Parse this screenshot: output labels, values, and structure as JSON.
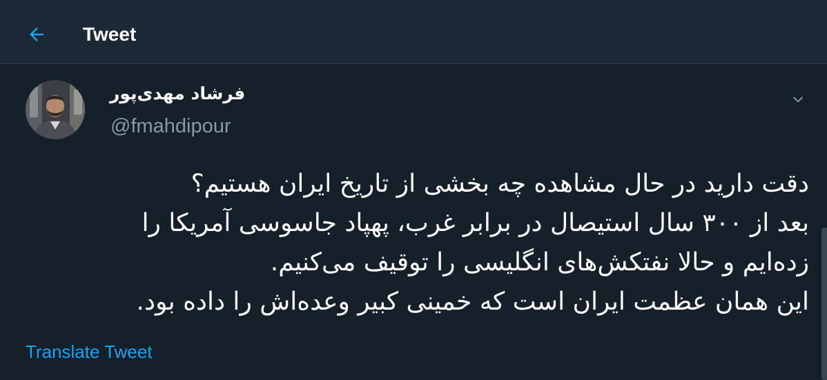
{
  "header": {
    "title": "Tweet",
    "back_icon": "arrow-left-icon",
    "accent_color": "#1da1f2"
  },
  "tweet": {
    "author": {
      "display_name": "فرشاد مهدی‌پور",
      "handle": "@fmahdipour",
      "avatar_icon": "avatar-photo"
    },
    "more_icon": "chevron-down-icon",
    "lines": [
      "دقت دارید در حال مشاهده چه بخشی از تاریخ ایران هستیم؟",
      "بعد از ۳۰۰ سال استیصال در برابر غرب، پهپاد جاسوسی آمریکا را",
      "زده‌ایم و حالا نفتکش‌های انگلیسی را توقیف می‌کنیم.",
      "این همان عظمت ایران است که خمینی کبیر وعده‌اش را داده بود."
    ],
    "translate_label": "Translate Tweet"
  },
  "colors": {
    "background": "#15202b",
    "header_background": "#1b2836",
    "secondary_text": "#8899a6",
    "link": "#1da1f2"
  }
}
